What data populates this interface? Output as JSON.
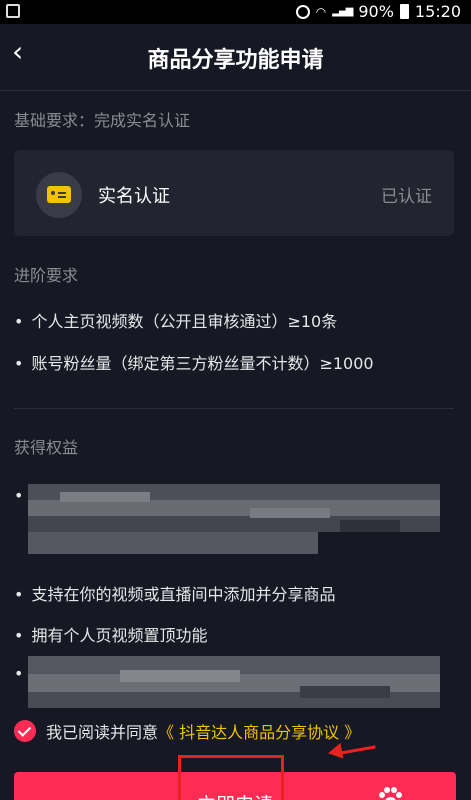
{
  "status_bar": {
    "battery": "90%",
    "time": "15:20"
  },
  "nav": {
    "back_icon": "chevron-left-icon",
    "title": "商品分享功能申请"
  },
  "basic_requirement": {
    "label": "基础要求：完成实名认证",
    "card": {
      "icon": "id-card-icon",
      "title": "实名认证",
      "status": "已认证"
    }
  },
  "advanced_requirement": {
    "label": "进阶要求",
    "items": [
      "个人主页视频数（公开且审核通过）≥10条",
      "账号粉丝量（绑定第三方粉丝量不计数）≥1000"
    ]
  },
  "benefits": {
    "label": "获得权益",
    "items": [
      "支持在你的视频或直播间中添加并分享商品",
      "拥有个人页视频置顶功能"
    ]
  },
  "agreement": {
    "prefix": "我已阅读并同意",
    "link": "《 抖音达人商品分享协议 》",
    "checked": true
  },
  "apply_button": {
    "label": "立即申请"
  },
  "colors": {
    "background": "#161823",
    "card": "#22242f",
    "accent": "#fe2c55",
    "link": "#f3c200",
    "annotation": "#e8231d"
  }
}
